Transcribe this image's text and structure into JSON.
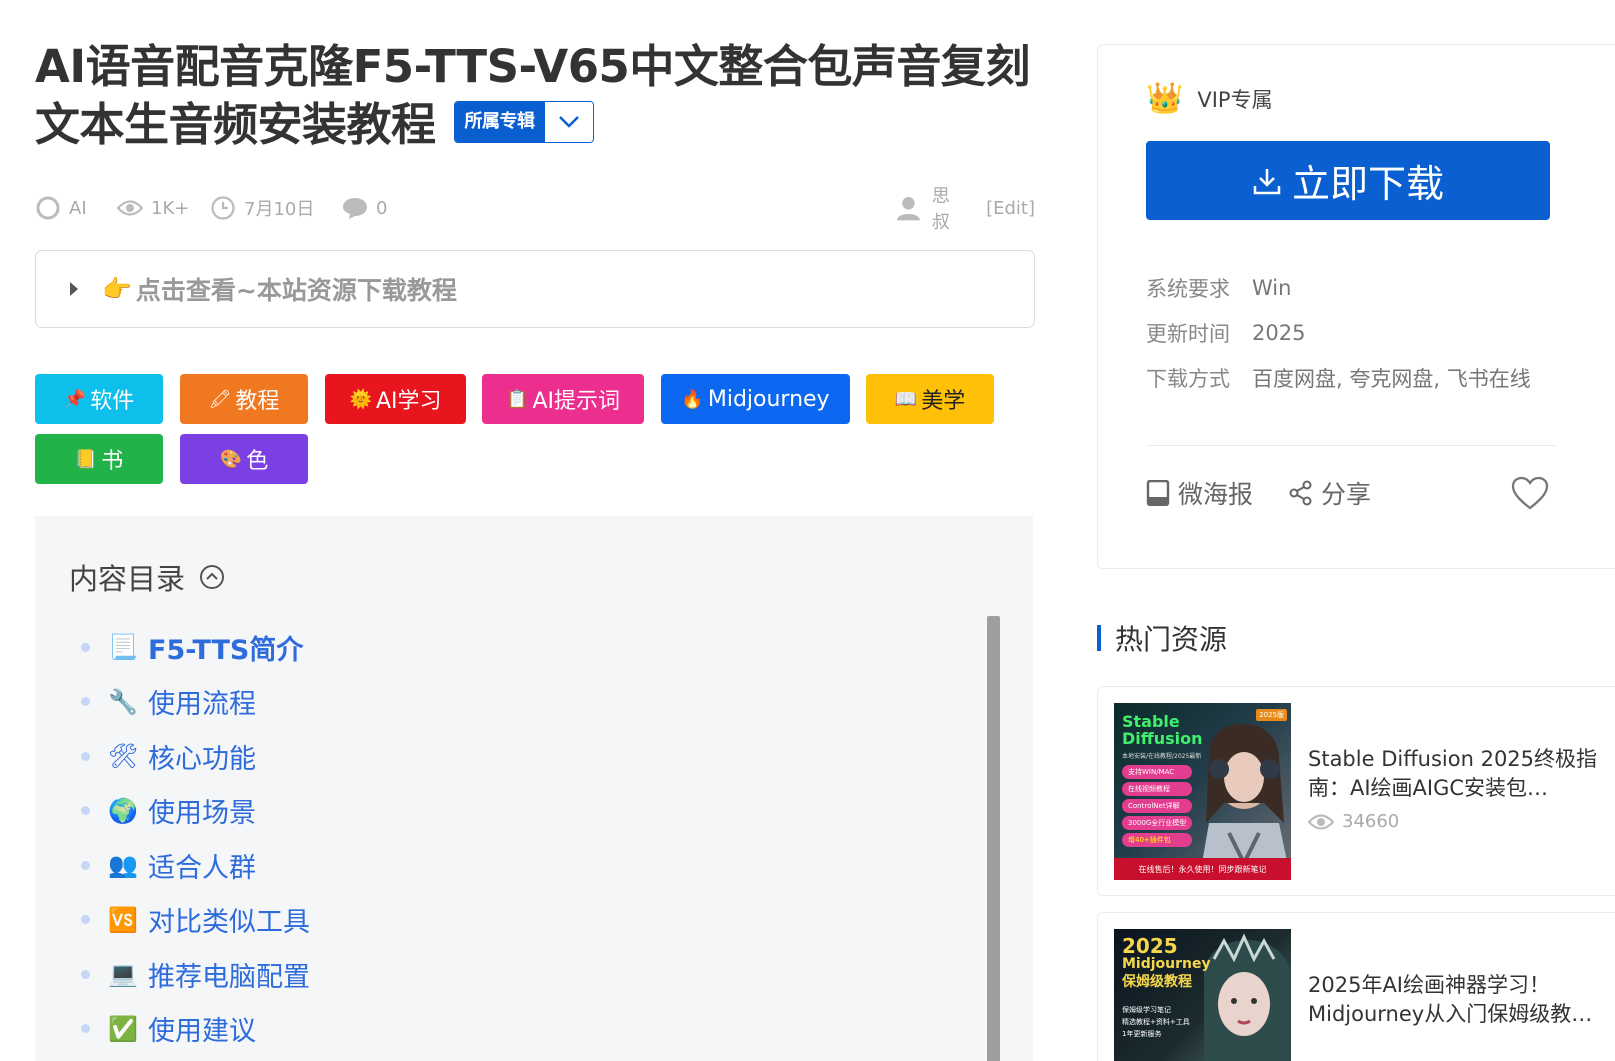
{
  "article": {
    "title": "AI语音配音克隆F5-TTS-V65中文整合包声音复刻文本生音频安装教程",
    "album_label": "所属专辑"
  },
  "meta": {
    "category": "AI",
    "views": "1K+",
    "date": "7月10日",
    "comments": "0",
    "author": "思叔",
    "edit": "[Edit]"
  },
  "notice": {
    "icon": "👉",
    "text": "点击查看~本站资源下载教程"
  },
  "tags": [
    {
      "icon": "📌",
      "label": "软件",
      "color": "#0dc0ec"
    },
    {
      "icon": "🖍",
      "label": "教程",
      "color": "#f07820"
    },
    {
      "icon": "🌞",
      "label": "AI学习",
      "color": "#e8141e"
    },
    {
      "icon": "📋",
      "label": "AI提示词",
      "color": "#ec2f8e"
    },
    {
      "icon": "🔥",
      "label": "Midjourney",
      "color": "#0c68f0"
    },
    {
      "icon": "📖",
      "label": "美学",
      "color": "#ffc107"
    },
    {
      "icon": "📒",
      "label": "书",
      "color": "#21b34a"
    },
    {
      "icon": "🎨",
      "label": "色",
      "color": "#7b3fe4"
    }
  ],
  "toc": {
    "title": "内容目录",
    "items": [
      {
        "icon": "📃",
        "label": "F5-TTS简介"
      },
      {
        "icon": "🔧",
        "label": "使用流程"
      },
      {
        "icon": "🛠",
        "label": "核心功能"
      },
      {
        "icon": "🌍",
        "label": "使用场景"
      },
      {
        "icon": "👥",
        "label": "适合人群"
      },
      {
        "icon": "🆚",
        "label": "对比类似工具"
      },
      {
        "icon": "💻",
        "label": "推荐电脑配置"
      },
      {
        "icon": "✅",
        "label": "使用建议"
      }
    ]
  },
  "download": {
    "vip_icon": "👑",
    "vip_label": "VIP专属",
    "button": "立即下载",
    "specs": [
      {
        "key": "系统要求",
        "value": "Win"
      },
      {
        "key": "更新时间",
        "value": "2025"
      },
      {
        "key": "下载方式",
        "value": "百度网盘, 夸克网盘, 飞书在线"
      }
    ],
    "poster": "微海报",
    "share": "分享"
  },
  "hot": {
    "title": "热门资源",
    "items": [
      {
        "title": "Stable Diffusion 2025终极指南：AI绘画AIGC安装包…",
        "views": "34660",
        "thumb_lines": [
          "Stable",
          "Diffusion"
        ],
        "thumb_sub": "本地安装/在线教程/2025最新",
        "thumb_pills": [
          "支持WIN/MAC",
          "在线视频教程",
          "ControlNet详解",
          "3000G全行业模型",
          "增40+插件包"
        ],
        "thumb_footer": "在线售后！永久使用！同步跟新笔记",
        "thumb_corner": "2025版"
      },
      {
        "title": "2025年AI绘画神器学习！Midjourney从入门保姆级教…",
        "thumb_lines": [
          "2025",
          "Midjourney",
          "保姆级教程"
        ],
        "thumb_pills": [
          "保姆级学习笔记",
          "精选教程+资料+工具",
          "1年更新服务"
        ]
      }
    ]
  }
}
